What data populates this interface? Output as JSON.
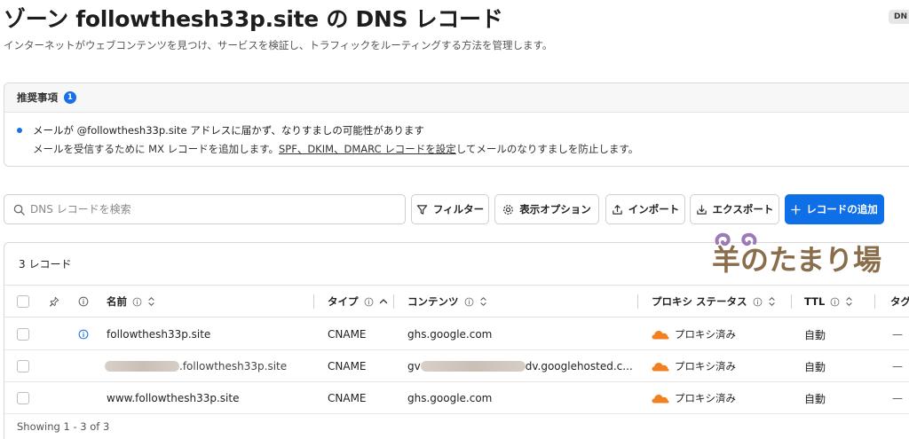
{
  "header": {
    "title": "ゾーン followthesh33p.site の DNS レコード",
    "subtitle": "インターネットがウェブコンテンツを見つけ、サービスを検証し、トラフィックをルーティングする方法を管理します。",
    "corner_badge": "DN"
  },
  "recommendations": {
    "title": "推奨事項",
    "count": "1",
    "line1": "メールが @followthesh33p.site アドレスに届かず、なりすましの可能性があります",
    "line2_prefix": "メールを受信するために MX レコードを追加します。",
    "line2_link": "SPF、DKIM、DMARC レコードを設定",
    "line2_suffix": "してメールのなりすましを防止します。"
  },
  "toolbar": {
    "search_placeholder": "DNS レコードを検索",
    "filter_label": "フィルター",
    "display_options_label": "表示オプション",
    "import_label": "インポート",
    "export_label": "エクスポート",
    "add_record_label": "レコードの追加"
  },
  "table": {
    "record_count": "3 レコード",
    "headers": {
      "name": "名前",
      "type": "タイプ",
      "content": "コンテンツ",
      "proxy_status": "プロキシ ステータス",
      "ttl": "TTL",
      "tags": "タグ"
    },
    "rows": [
      {
        "name": "followthesh33p.site",
        "type": "CNAME",
        "content": "ghs.google.com",
        "proxy": "プロキシ済み",
        "ttl": "自動",
        "tags": "—"
      },
      {
        "name": ".followthesh33p.site",
        "type": "CNAME",
        "content_prefix": "gv",
        "content": "dv.googlehosted.c...",
        "proxy": "プロキシ済み",
        "ttl": "自動",
        "tags": "—"
      },
      {
        "name": "www.followthesh33p.site",
        "type": "CNAME",
        "content": "ghs.google.com",
        "proxy": "プロキシ済み",
        "ttl": "自動",
        "tags": "—"
      }
    ],
    "footer": "Showing 1 - 3 of 3"
  },
  "watermark": {
    "text": "羊のたまり場"
  },
  "colors": {
    "accent": "#0f6fe6",
    "cloud": "#f38020",
    "watermark_text": "#8a6d4a"
  }
}
